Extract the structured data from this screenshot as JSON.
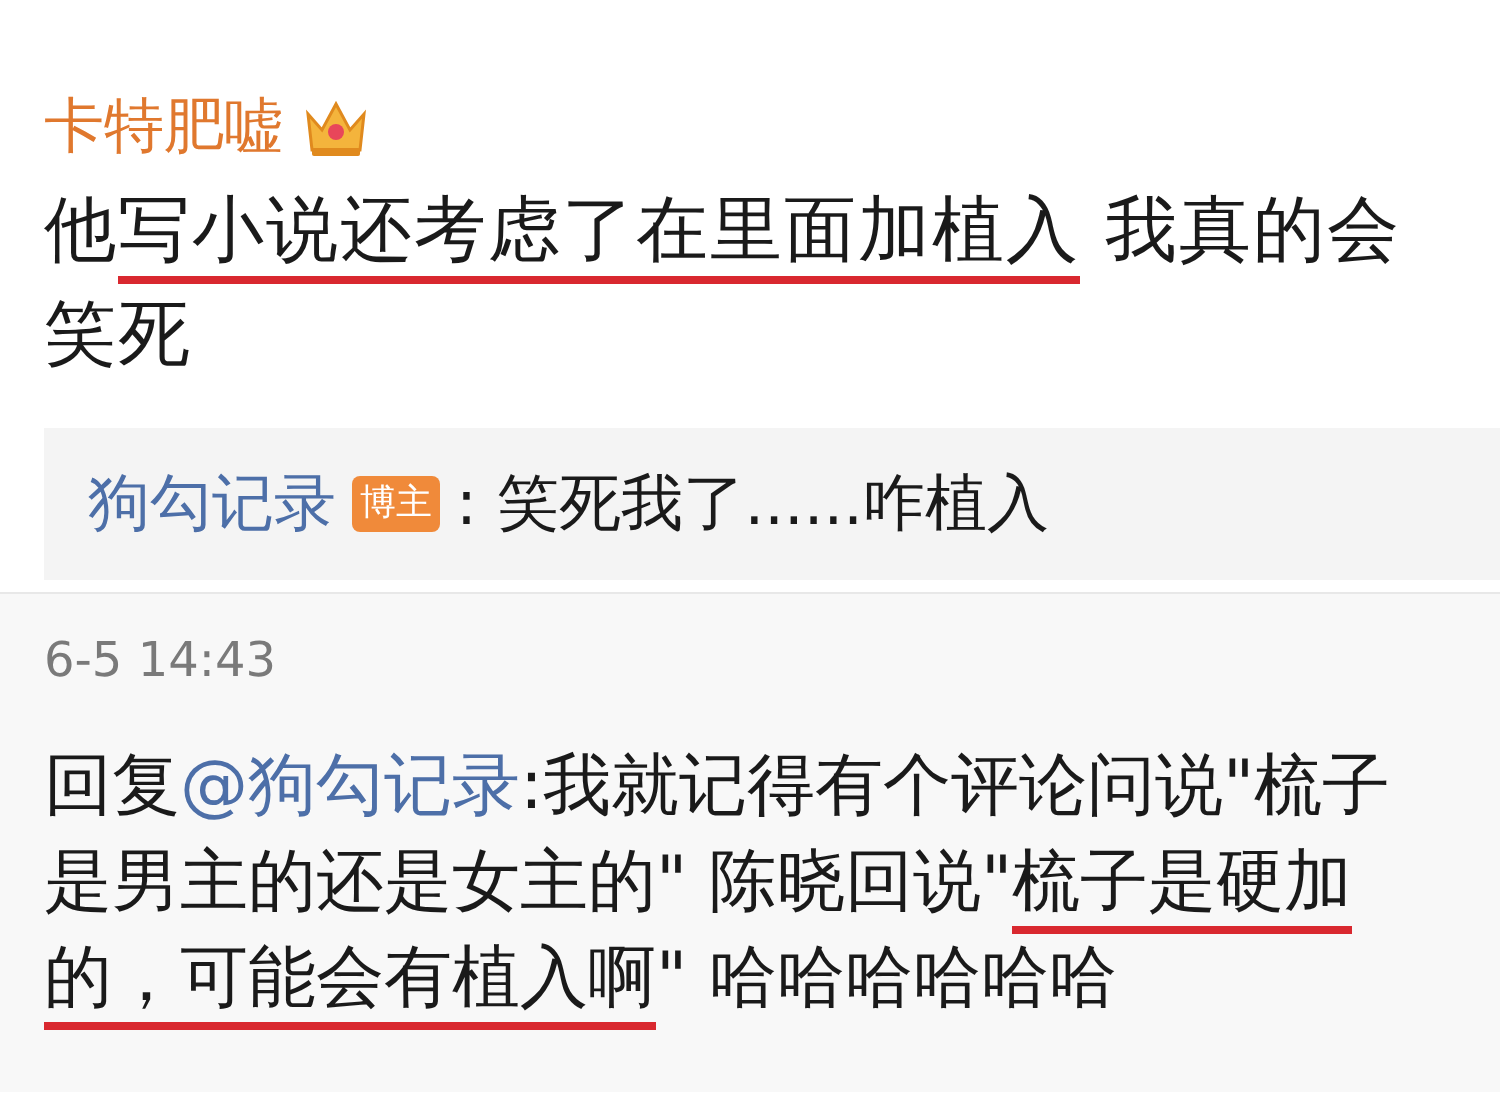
{
  "comment": {
    "username": "卡特肥嘘",
    "text": [
      {
        "text": "他",
        "underlined": false
      },
      {
        "text": "写小说还考虑了在里面加植入",
        "underlined": true
      },
      {
        "text": " 我真的会笑死",
        "underlined": false
      }
    ]
  },
  "reply_preview": {
    "author": "狗勾记录",
    "badge": "博主",
    "text": ": 笑死我了......咋植入"
  },
  "reply": {
    "time": "6-5 14:43",
    "prefix": "回复",
    "mention": "@狗勾记录",
    "text": [
      {
        "text": ":我就记得有个评论问说\"梳子是男主的还是女主的\" 陈晓回说\"",
        "underlined": false
      },
      {
        "text": "梳子是硬加的，可能会有植入啊",
        "underlined": true
      },
      {
        "text": "\" 哈哈哈哈哈哈",
        "underlined": false
      }
    ]
  }
}
